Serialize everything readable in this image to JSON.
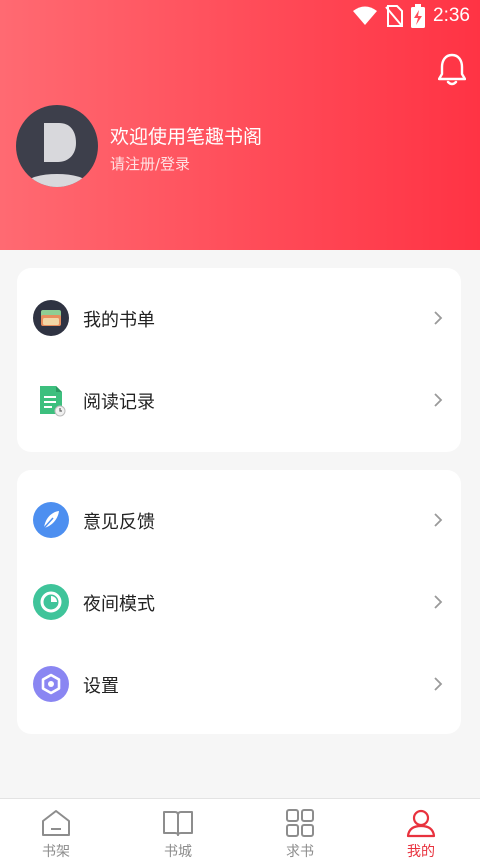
{
  "status_bar": {
    "time": "2:36"
  },
  "header": {
    "welcome": "欢迎使用笔趣书阁",
    "register": "请注册/登录"
  },
  "menu_group_1": [
    {
      "label": "我的书单",
      "icon": "book-list-icon"
    },
    {
      "label": "阅读记录",
      "icon": "reading-record-icon"
    }
  ],
  "menu_group_2": [
    {
      "label": "意见反馈",
      "icon": "feedback-icon"
    },
    {
      "label": "夜间模式",
      "icon": "night-mode-icon"
    },
    {
      "label": "设置",
      "icon": "settings-icon"
    }
  ],
  "tabbar": [
    {
      "label": "书架",
      "icon": "bookshelf-icon",
      "active": false
    },
    {
      "label": "书城",
      "icon": "bookstore-icon",
      "active": false
    },
    {
      "label": "求书",
      "icon": "request-book-icon",
      "active": false
    },
    {
      "label": "我的",
      "icon": "profile-icon",
      "active": true
    }
  ],
  "colors": {
    "header_start": "#ff6a72",
    "header_end": "#ff3344",
    "accent": "#e8323e"
  }
}
